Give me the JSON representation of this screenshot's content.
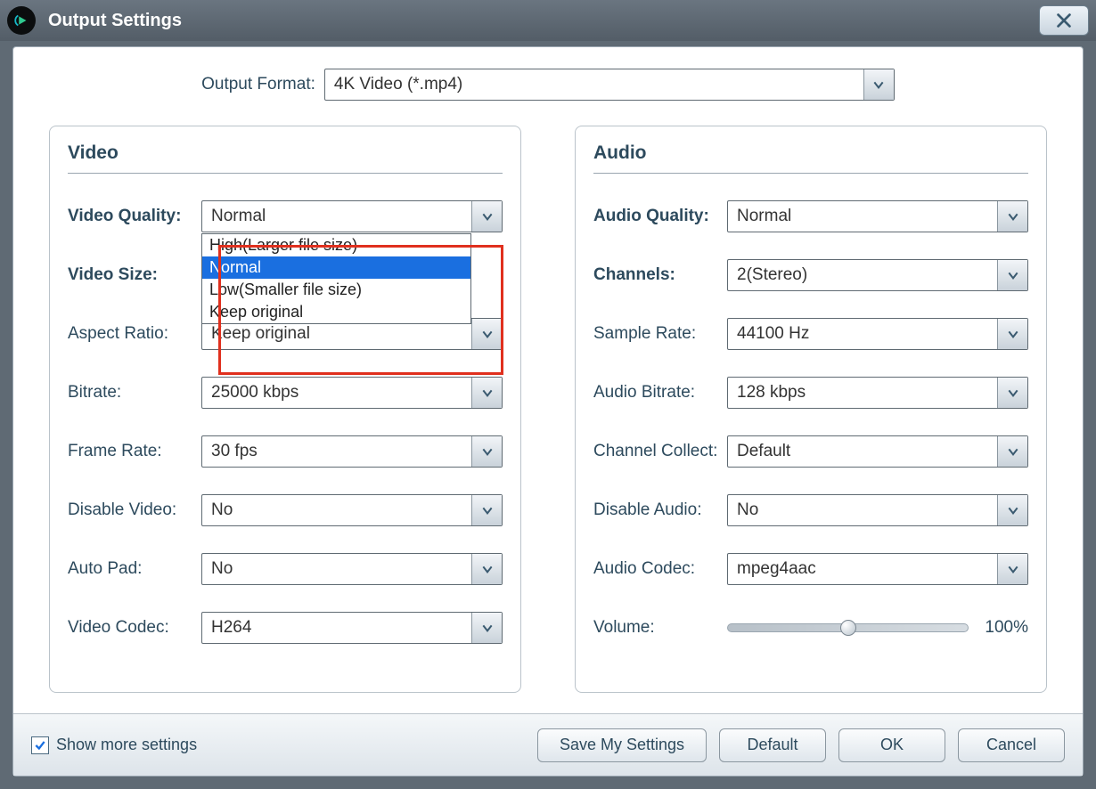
{
  "window": {
    "title": "Output Settings"
  },
  "format": {
    "label": "Output Format:",
    "value": "4K Video (*.mp4)"
  },
  "video": {
    "group_title": "Video",
    "quality": {
      "label": "Video Quality:",
      "value": "Normal",
      "options": [
        "High(Larger file size)",
        "Normal",
        "Low(Smaller file size)",
        "Keep original"
      ],
      "selected_index": 1
    },
    "size": {
      "label": "Video Size:"
    },
    "aspect": {
      "label": "Aspect Ratio:",
      "value": "Keep original"
    },
    "bitrate": {
      "label": "Bitrate:",
      "value": "25000 kbps"
    },
    "framerate": {
      "label": "Frame Rate:",
      "value": "30 fps"
    },
    "disable": {
      "label": "Disable Video:",
      "value": "No"
    },
    "autopad": {
      "label": "Auto Pad:",
      "value": "No"
    },
    "codec": {
      "label": "Video Codec:",
      "value": "H264"
    }
  },
  "audio": {
    "group_title": "Audio",
    "quality": {
      "label": "Audio Quality:",
      "value": "Normal"
    },
    "channels": {
      "label": "Channels:",
      "value": "2(Stereo)"
    },
    "sample": {
      "label": "Sample Rate:",
      "value": "44100 Hz"
    },
    "bitrate": {
      "label": "Audio Bitrate:",
      "value": "128 kbps"
    },
    "collect": {
      "label": "Channel Collect:",
      "value": "Default"
    },
    "disable": {
      "label": "Disable Audio:",
      "value": "No"
    },
    "codec": {
      "label": "Audio Codec:",
      "value": "mpeg4aac"
    },
    "volume": {
      "label": "Volume:",
      "value": "100%",
      "percent": 50
    }
  },
  "footer": {
    "show_more": "Show more settings",
    "show_more_checked": true,
    "save": "Save My Settings",
    "default": "Default",
    "ok": "OK",
    "cancel": "Cancel"
  }
}
